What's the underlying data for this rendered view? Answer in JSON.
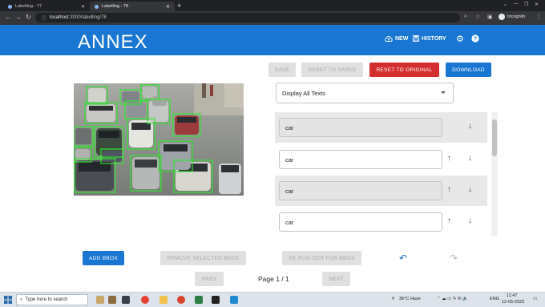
{
  "browser": {
    "tabs": [
      {
        "title": "Labelling - 77",
        "active": false
      },
      {
        "title": "Labelling - 78",
        "active": true
      }
    ],
    "url_host": "localhost",
    "url_rest": ":3000/labelling/78",
    "profile": "Incognito"
  },
  "appbar": {
    "brand": "ANNEX",
    "new_label": "NEW",
    "history_label": "HISTORY",
    "color": "#1976d2"
  },
  "toolbar": {
    "save": "SAVE",
    "reset_saved": "RESET TO SAVED",
    "reset_original": "RESET TO ORIGINAL",
    "download": "DOWNLOAD"
  },
  "select": {
    "value": "Display All Texts"
  },
  "texts": [
    {
      "value": "car",
      "selected": true
    },
    {
      "value": "car",
      "selected": false
    },
    {
      "value": "car",
      "selected": true
    },
    {
      "value": "car",
      "selected": false
    }
  ],
  "bottom": {
    "add_bbox": "ADD BBOX",
    "remove_bbox": "REMOVE SELECTED BBOX",
    "rerun_ocr": "RE RUN OCR FOR BBOX",
    "prev": "PREV",
    "page": "Page 1 / 1",
    "next": "NEXT"
  },
  "taskbar": {
    "search_placeholder": "Type here to search",
    "weather": "36°C  Haze",
    "lang": "ENG",
    "time": "11:47",
    "date": "12-05-2023"
  }
}
